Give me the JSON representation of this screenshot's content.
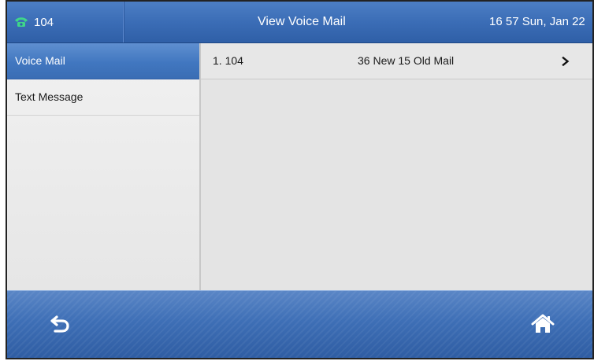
{
  "status_bar": {
    "account_icon": "phone-handset-icon",
    "account": "104",
    "title": "View Voice Mail",
    "clock": "16 57 Sun, Jan 22"
  },
  "sidebar": {
    "items": [
      {
        "label": "Voice Mail",
        "active": true
      },
      {
        "label": "Text Message",
        "active": false
      }
    ]
  },
  "voicemail_list": {
    "rows": [
      {
        "account": "1. 104",
        "messages": "36 New 15 Old Mail",
        "action_icon": "chevron-right-icon"
      }
    ]
  },
  "softkeys": {
    "back_icon": "back-arrow-icon",
    "home_icon": "home-icon"
  },
  "colors": {
    "accent_blue": "#3b6db6",
    "active_item": "#4177c0",
    "phone_icon": "#3fd68a"
  }
}
